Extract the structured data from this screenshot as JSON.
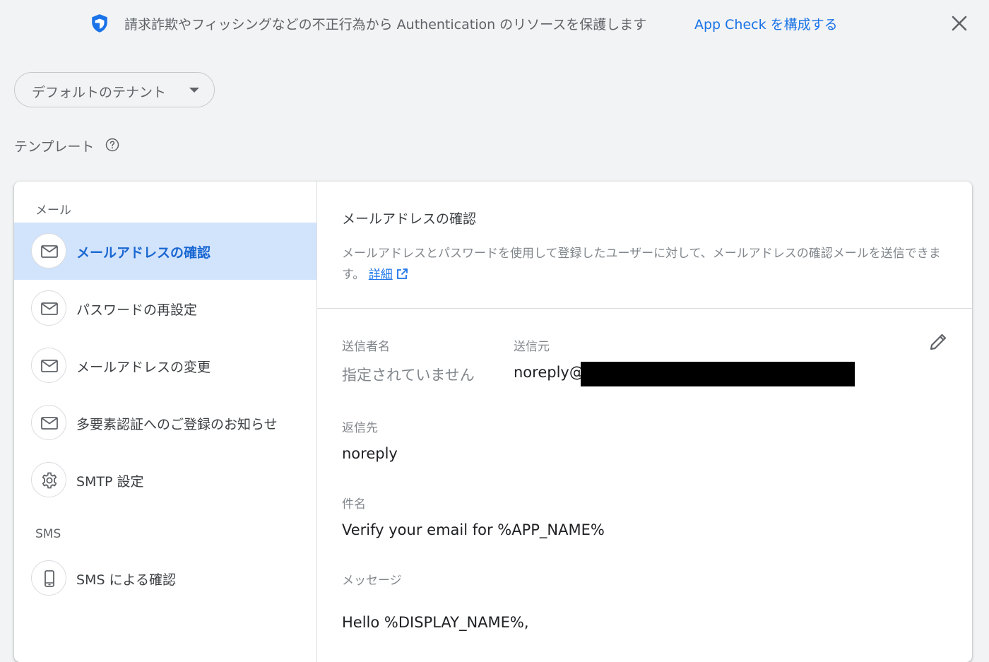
{
  "banner": {
    "message": "請求詐欺やフィッシングなどの不正行為から Authentication のリソースを保護します",
    "link_label": "App Check を構成する"
  },
  "tenant_selector": {
    "value": "デフォルトのテナント"
  },
  "templates": {
    "title": "テンプレート",
    "email_section": "メール",
    "sms_section": "SMS",
    "items": [
      {
        "label": "メールアドレスの確認",
        "icon": "mail-icon",
        "active": true
      },
      {
        "label": "パスワードの再設定",
        "icon": "mail-icon",
        "active": false
      },
      {
        "label": "メールアドレスの変更",
        "icon": "mail-icon",
        "active": false
      },
      {
        "label": "多要素認証へのご登録のお知らせ",
        "icon": "mail-icon",
        "active": false
      },
      {
        "label": "SMTP 設定",
        "icon": "gear-icon",
        "active": false
      },
      {
        "label": "SMS による確認",
        "icon": "phone-icon",
        "active": false
      }
    ]
  },
  "detail": {
    "title": "メールアドレスの確認",
    "description": "メールアドレスとパスワードを使用して登録したユーザーに対して、メールアドレスの確認メールを送信できます。",
    "learn_more": "詳細",
    "sender_name_label": "送信者名",
    "sender_name_value": "指定されていません",
    "from_label": "送信元",
    "from_value": "noreply@",
    "reply_to_label": "返信先",
    "reply_to_value": "noreply",
    "subject_label": "件名",
    "subject_value": "Verify your email for %APP_NAME%",
    "message_label": "メッセージ",
    "message_value": "Hello %DISPLAY_NAME%,"
  },
  "colors": {
    "accent": "#1a73e8",
    "active_bg": "#d2e3fc",
    "active_text": "#1967d2"
  }
}
